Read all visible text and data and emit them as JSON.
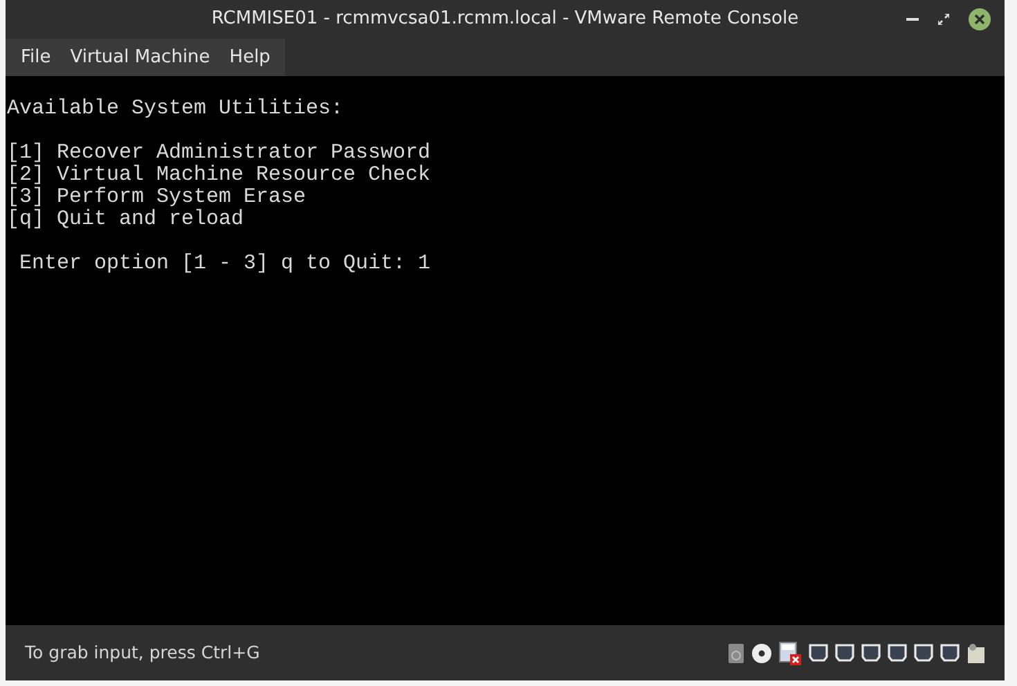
{
  "window": {
    "title": "RCMMISE01 - rcmmvcsa01.rcmm.local - VMware Remote Console"
  },
  "menu": [
    {
      "label": "File"
    },
    {
      "label": "Virtual Machine"
    },
    {
      "label": "Help"
    }
  ],
  "console": {
    "heading": "Available System Utilities:",
    "options": [
      "[1] Recover Administrator Password",
      "[2] Virtual Machine Resource Check",
      "[3] Perform System Erase",
      "[q] Quit and reload"
    ],
    "prompt": " Enter option [1 - 3] q to Quit: 1"
  },
  "status_bar": {
    "text": "To grab input, press Ctrl+G"
  }
}
